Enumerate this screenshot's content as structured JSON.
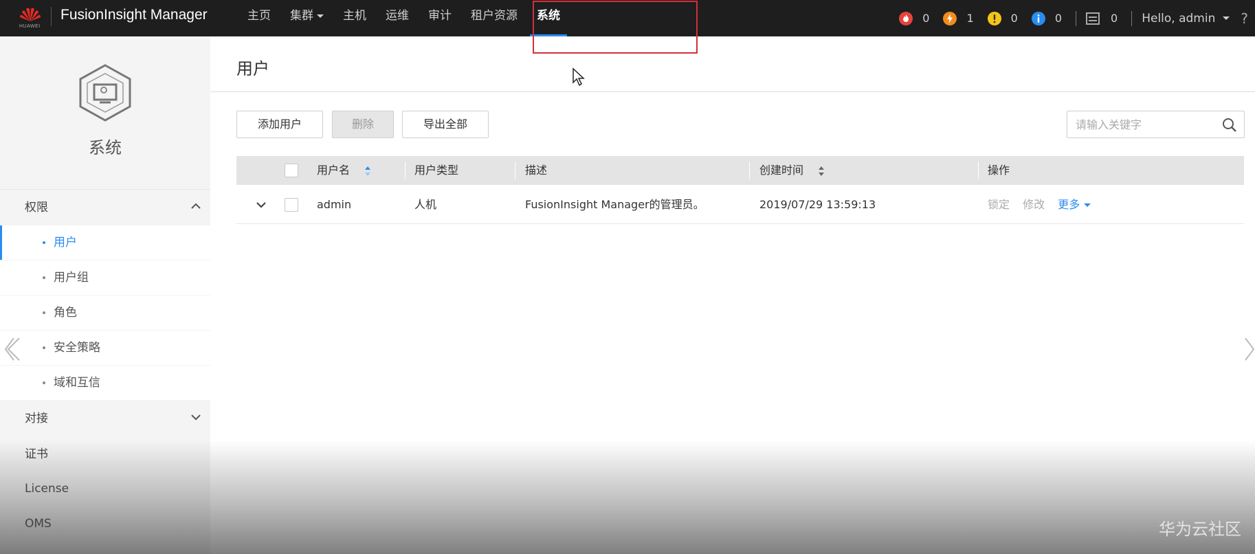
{
  "header": {
    "logo_text": "HUAWEI",
    "brand": "FusionInsight Manager",
    "nav": [
      {
        "label": "主页"
      },
      {
        "label": "集群"
      },
      {
        "label": "主机"
      },
      {
        "label": "运维"
      },
      {
        "label": "审计"
      },
      {
        "label": "租户资源"
      },
      {
        "label": "系统"
      }
    ],
    "active_nav": "系统",
    "alarms": [
      {
        "type": "critical",
        "count": "0",
        "color": "#e5443b",
        "icon": "fire-icon"
      },
      {
        "type": "major",
        "count": "1",
        "color": "#f28b1d",
        "icon": "lightning-icon"
      },
      {
        "type": "minor",
        "count": "0",
        "color": "#f5c518",
        "icon": "exclamation-icon"
      },
      {
        "type": "warning",
        "count": "0",
        "color": "#2a8cf0",
        "icon": "info-icon"
      }
    ],
    "tasks_count": "0",
    "user_greeting": "Hello, admin",
    "help": "?"
  },
  "sidebar": {
    "title": "系统",
    "groups": [
      {
        "label": "权限",
        "expanded": true
      },
      {
        "label": "对接",
        "expanded": false
      },
      {
        "label": "证书"
      },
      {
        "label": "License"
      },
      {
        "label": "OMS"
      }
    ],
    "items": [
      {
        "label": "用户",
        "active": true
      },
      {
        "label": "用户组"
      },
      {
        "label": "角色"
      },
      {
        "label": "安全策略"
      },
      {
        "label": "域和互信"
      }
    ]
  },
  "main": {
    "title": "用户",
    "toolbar": {
      "add_label": "添加用户",
      "delete_label": "删除",
      "export_label": "导出全部"
    },
    "search": {
      "placeholder": "请输入关键字"
    },
    "table": {
      "columns": [
        "用户名",
        "用户类型",
        "描述",
        "创建时间",
        "操作"
      ],
      "rows": [
        {
          "username": "admin",
          "type": "人机",
          "description": "FusionInsight Manager的管理员。",
          "created": "2019/07/29 13:59:13",
          "actions": [
            "锁定",
            "修改",
            "更多"
          ]
        }
      ]
    }
  },
  "watermark": "华为云社区",
  "colors": {
    "accent": "#2a8cf0",
    "topbar": "#1e1e1e",
    "highlight": "#d0303a"
  }
}
